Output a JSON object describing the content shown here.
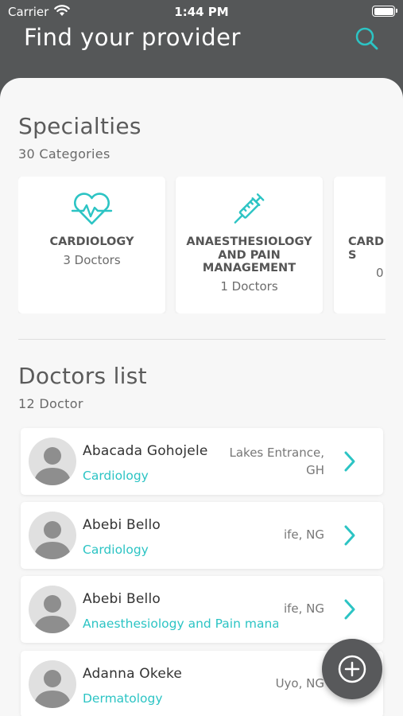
{
  "status_bar": {
    "carrier": "Carrier",
    "time": "1:44 PM"
  },
  "header": {
    "title": "Find your provider",
    "search_icon": "search-icon"
  },
  "specialties": {
    "title": "Specialties",
    "subtitle": "30 Categories",
    "items": [
      {
        "name": "CARDIOLOGY",
        "count": "3 Doctors",
        "icon": "heart-pulse-icon"
      },
      {
        "name": "ANAESTHESIOLOGY AND PAIN MANAGEMENT",
        "count": "1 Doctors",
        "icon": "syringe-icon"
      },
      {
        "name": "CARD S",
        "count": "0"
      }
    ]
  },
  "doctors": {
    "title": "Doctors list",
    "subtitle": "12 Doctor",
    "items": [
      {
        "name": "Abacada Gohojele",
        "specialty": "Cardiology",
        "location": "Lakes Entrance, GH"
      },
      {
        "name": "Abebi Bello",
        "specialty": "Cardiology",
        "location": "ife, NG"
      },
      {
        "name": "Abebi Bello",
        "specialty": "Anaesthesiology and Pain management",
        "location": "ife, NG"
      },
      {
        "name": "Adanna Okeke",
        "specialty": "Dermatology",
        "location": "Uyo, NG"
      }
    ]
  },
  "colors": {
    "accent": "#2cc4c4",
    "header_bg": "#555758",
    "sheet_bg": "#f7f7f7"
  },
  "fab_icon": "plus-circle-icon"
}
